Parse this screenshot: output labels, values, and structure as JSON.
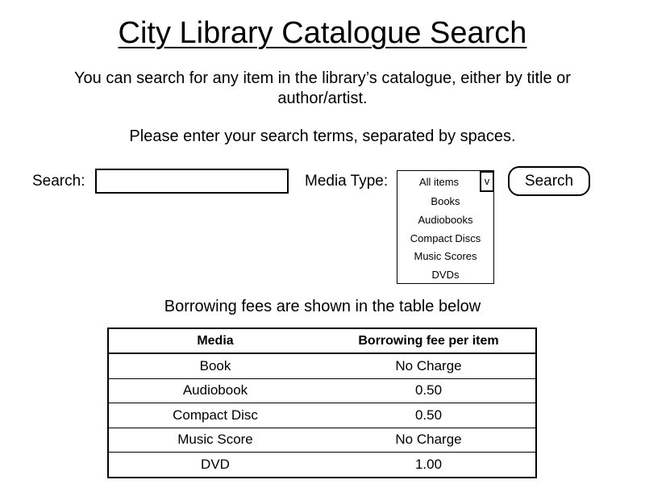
{
  "page": {
    "title": "City Library Catalogue Search",
    "intro": "You can search for any item in the library’s catalogue, either by title or author/artist.",
    "instructions": "Please enter your search terms, separated by spaces."
  },
  "search": {
    "label": "Search:",
    "value": "",
    "placeholder": ""
  },
  "media_type": {
    "label": "Media Type:",
    "selected": "All items",
    "arrow_glyph": "v",
    "options": [
      "Books",
      "Audiobooks",
      "Compact Discs",
      "Music Scores",
      "DVDs"
    ]
  },
  "search_button": {
    "label": "Search"
  },
  "fees": {
    "caption": "Borrowing fees are shown in the table below",
    "headers": [
      "Media",
      "Borrowing fee per item"
    ],
    "rows": [
      {
        "media": "Book",
        "fee": "No Charge"
      },
      {
        "media": "Audiobook",
        "fee": "0.50"
      },
      {
        "media": "Compact Disc",
        "fee": "0.50"
      },
      {
        "media": "Music Score",
        "fee": "No Charge"
      },
      {
        "media": "DVD",
        "fee": "1.00"
      }
    ]
  }
}
